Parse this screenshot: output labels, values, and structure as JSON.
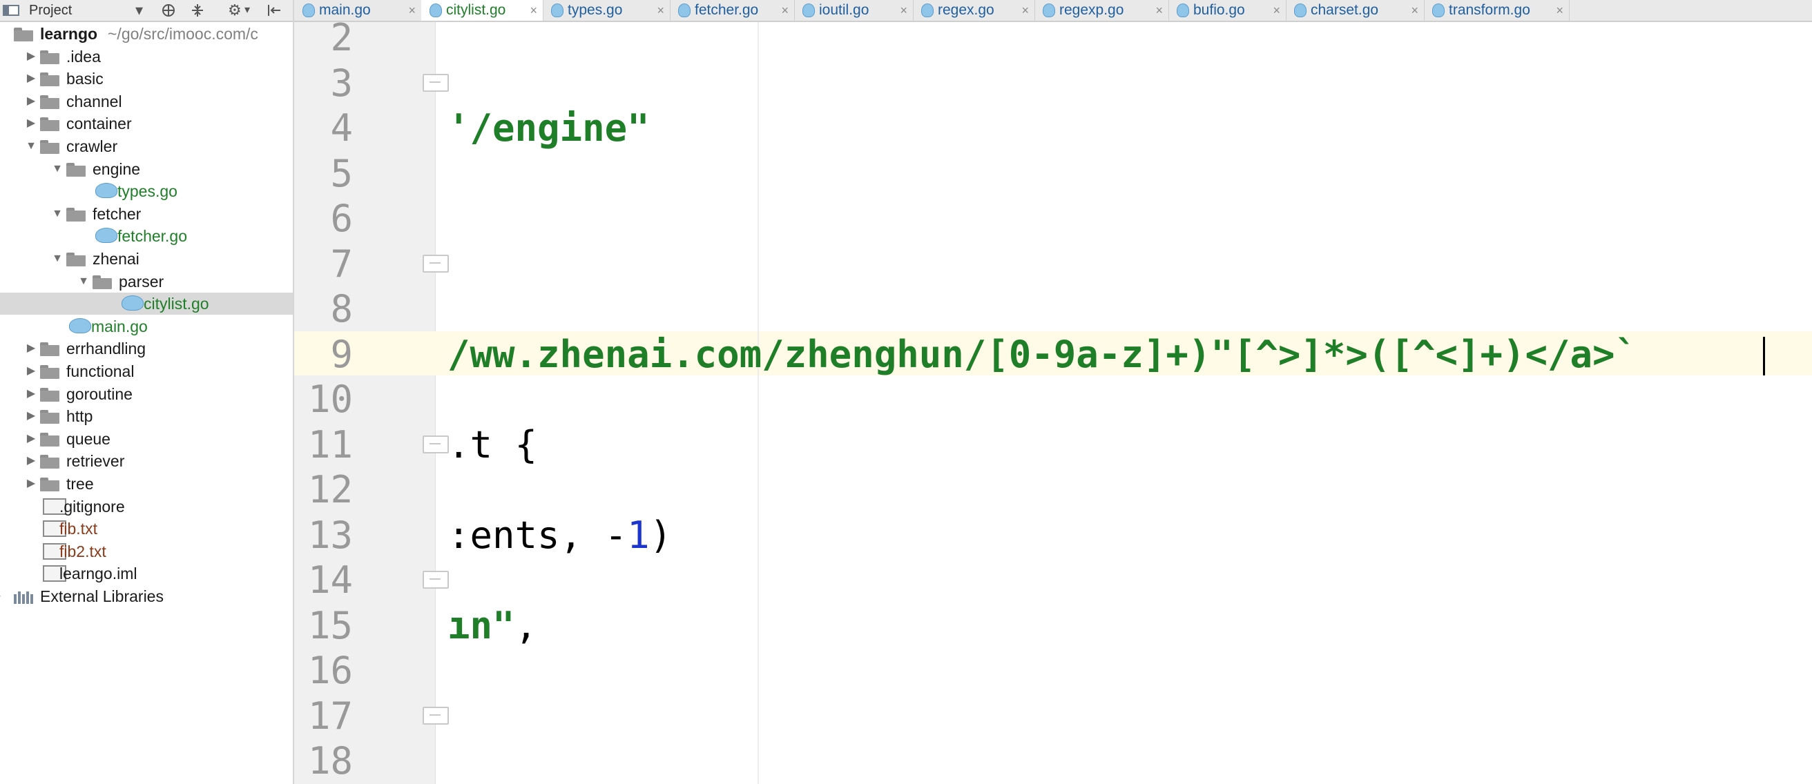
{
  "project_panel": {
    "title": "Project",
    "toolbar_icons": [
      "chevron-down-icon",
      "crosshair-icon",
      "collapse-icon",
      "gear-icon",
      "hide-icon"
    ]
  },
  "tree": [
    {
      "label": "learngo",
      "hint": " ~/go/src/imooc.com/c",
      "type": "module",
      "indent": 0,
      "expanded": true
    },
    {
      "label": ".idea",
      "type": "folder",
      "indent": 1,
      "expanded": false
    },
    {
      "label": "basic",
      "type": "folder",
      "indent": 1,
      "expanded": false
    },
    {
      "label": "channel",
      "type": "folder",
      "indent": 1,
      "expanded": false
    },
    {
      "label": "container",
      "type": "folder",
      "indent": 1,
      "expanded": false
    },
    {
      "label": "crawler",
      "type": "folder",
      "indent": 1,
      "expanded": true
    },
    {
      "label": "engine",
      "type": "folder",
      "indent": 2,
      "expanded": true
    },
    {
      "label": "types.go",
      "type": "go",
      "indent": 3
    },
    {
      "label": "fetcher",
      "type": "folder",
      "indent": 2,
      "expanded": true
    },
    {
      "label": "fetcher.go",
      "type": "go",
      "indent": 3
    },
    {
      "label": "zhenai",
      "type": "folder",
      "indent": 2,
      "expanded": true
    },
    {
      "label": "parser",
      "type": "folder",
      "indent": 3,
      "expanded": true
    },
    {
      "label": "citylist.go",
      "type": "go",
      "indent": 4,
      "selected": true
    },
    {
      "label": "main.go",
      "type": "go",
      "indent": 2
    },
    {
      "label": "errhandling",
      "type": "folder",
      "indent": 1,
      "expanded": false
    },
    {
      "label": "functional",
      "type": "folder",
      "indent": 1,
      "expanded": false
    },
    {
      "label": "goroutine",
      "type": "folder",
      "indent": 1,
      "expanded": false
    },
    {
      "label": "http",
      "type": "folder",
      "indent": 1,
      "expanded": false
    },
    {
      "label": "queue",
      "type": "folder",
      "indent": 1,
      "expanded": false
    },
    {
      "label": "retriever",
      "type": "folder",
      "indent": 1,
      "expanded": false
    },
    {
      "label": "tree",
      "type": "folder",
      "indent": 1,
      "expanded": false
    },
    {
      "label": ".gitignore",
      "type": "file",
      "indent": 1
    },
    {
      "label": "fib.txt",
      "type": "file-brown",
      "indent": 1
    },
    {
      "label": "fib2.txt",
      "type": "file-brown",
      "indent": 1
    },
    {
      "label": "learngo.iml",
      "type": "file",
      "indent": 1
    },
    {
      "label": "External Libraries",
      "type": "lib",
      "indent": 0,
      "expanded": false
    }
  ],
  "tabs": [
    {
      "label": "main.go",
      "active": false
    },
    {
      "label": "citylist.go",
      "active": true
    },
    {
      "label": "types.go",
      "active": false
    },
    {
      "label": "fetcher.go",
      "active": false
    },
    {
      "label": "ioutil.go",
      "active": false
    },
    {
      "label": "regex.go",
      "active": false
    },
    {
      "label": "regexp.go",
      "active": false
    },
    {
      "label": "bufio.go",
      "active": false
    },
    {
      "label": "charset.go",
      "active": false
    },
    {
      "label": "transform.go",
      "active": false
    }
  ],
  "tab_close_glyph": "×",
  "editor": {
    "current_line": 9,
    "lines": [
      {
        "num": "2",
        "parts": []
      },
      {
        "num": "3",
        "parts": [],
        "fold": true
      },
      {
        "num": "4",
        "parts": [
          {
            "t": "'/engine\"",
            "c": "str"
          }
        ]
      },
      {
        "num": "5",
        "parts": []
      },
      {
        "num": "6",
        "parts": []
      },
      {
        "num": "7",
        "parts": [],
        "fold": true
      },
      {
        "num": "8",
        "parts": []
      },
      {
        "num": "9",
        "parts": [
          {
            "t": "/ww.zhenai.com/zhenghun/[0-9a-z]+)\"[^>]*>([^<]+)</a>`",
            "c": "str"
          }
        ]
      },
      {
        "num": "10",
        "parts": []
      },
      {
        "num": "11",
        "parts": [
          {
            "t": ".t {",
            "c": ""
          }
        ],
        "fold": true
      },
      {
        "num": "12",
        "parts": []
      },
      {
        "num": "13",
        "parts": [
          {
            "t": ":ents, -",
            "c": ""
          },
          {
            "t": "1",
            "c": "num"
          },
          {
            "t": ")",
            "c": ""
          }
        ]
      },
      {
        "num": "14",
        "parts": [],
        "fold": true
      },
      {
        "num": "15",
        "parts": [
          {
            "t": "ın\"",
            "c": "str"
          },
          {
            "t": ",",
            "c": ""
          }
        ]
      },
      {
        "num": "16",
        "parts": []
      },
      {
        "num": "17",
        "parts": [],
        "fold": true
      },
      {
        "num": "18",
        "parts": []
      }
    ]
  }
}
